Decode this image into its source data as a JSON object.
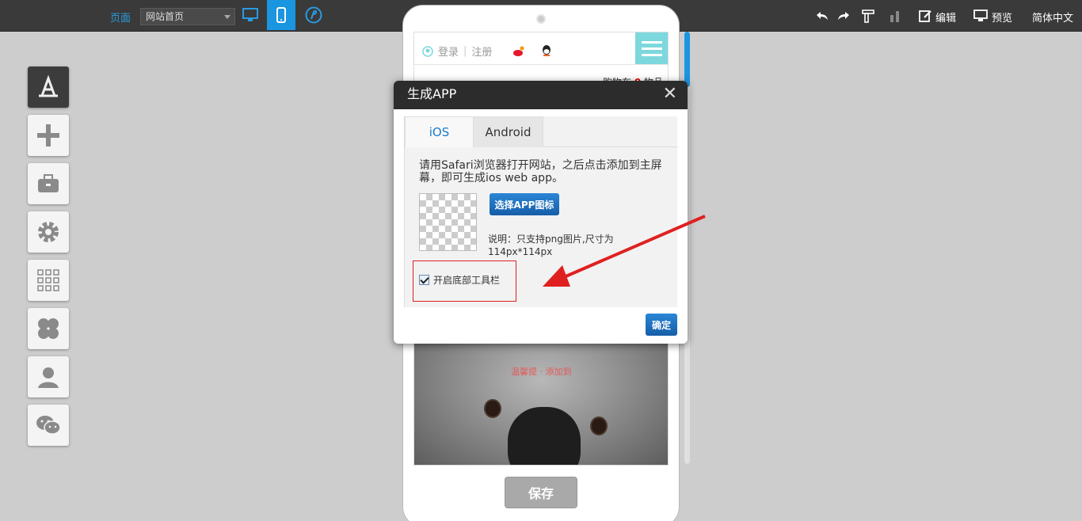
{
  "topbar": {
    "page_label": "页面",
    "page_select_value": "网站首页",
    "edit_label": "编辑",
    "preview_label": "预览",
    "language_label": "简体中文"
  },
  "phone": {
    "login_label": "登录",
    "register_label": "注册",
    "cart_label": "购物车",
    "cart_count": "0",
    "cart_suffix": "物品",
    "koala_text": "温馨提 · 添加到"
  },
  "save_label": "保存",
  "modal": {
    "title": "生成APP",
    "close_label": "✕",
    "tabs": [
      {
        "label": "iOS"
      },
      {
        "label": "Android"
      }
    ],
    "description": "请用Safari浏览器打开网站，之后点击添加到主屏幕，即可生成ios web app。",
    "choose_icon_label": "选择APP图标",
    "note": "说明：只支持png图片,尺寸为114px*114px",
    "bottom_toolbar_label": "开启底部工具栏",
    "bottom_toolbar_checked": true,
    "confirm_label": "确定"
  },
  "colors": {
    "accent": "#1a95e0",
    "annotation_red": "#e02020",
    "menu_teal": "#7dd8dd"
  }
}
